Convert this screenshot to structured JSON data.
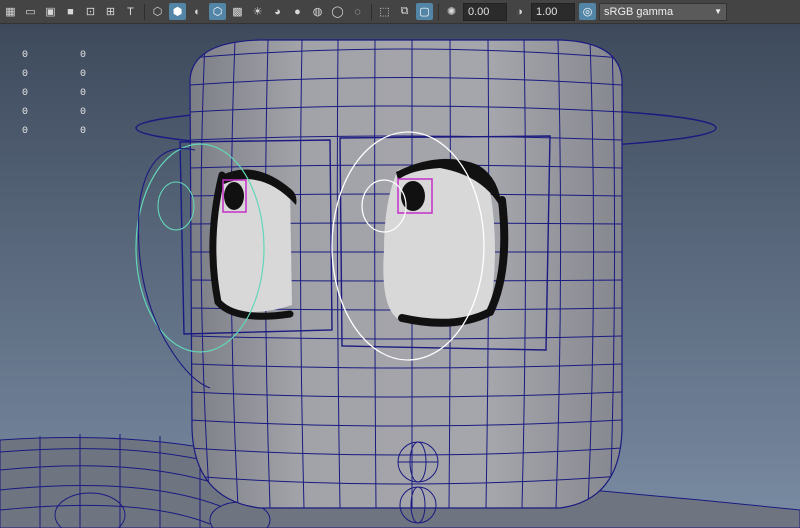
{
  "toolbar": {
    "icons": [
      {
        "name": "camera-attributes-icon",
        "glyph": "▦",
        "active": false
      },
      {
        "name": "image-plane-icon",
        "glyph": "▭",
        "active": false
      },
      {
        "name": "film-gate-icon",
        "glyph": "▣",
        "active": false
      },
      {
        "name": "resolution-gate-icon",
        "glyph": "■",
        "active": false
      },
      {
        "name": "safe-action-icon",
        "glyph": "⊡",
        "active": false
      },
      {
        "name": "grid-icon",
        "glyph": "⊞",
        "active": false
      },
      {
        "name": "text-field-icon",
        "glyph": "T",
        "active": false
      },
      {
        "name": "wireframe-icon",
        "glyph": "⬡",
        "active": false
      },
      {
        "name": "smooth-shade-icon",
        "glyph": "⬢",
        "active": true
      },
      {
        "name": "shadows-icon",
        "glyph": "◐",
        "active": false
      },
      {
        "name": "wireframe-on-shaded-icon",
        "glyph": "⬡",
        "active": true
      },
      {
        "name": "textured-icon",
        "glyph": "▩",
        "active": false
      },
      {
        "name": "lighting-icon",
        "glyph": "☀",
        "active": false
      },
      {
        "name": "xray-icon",
        "glyph": "◕",
        "active": false
      },
      {
        "name": "ambient-occlusion-icon",
        "glyph": "●",
        "active": false
      },
      {
        "name": "motion-blur-icon",
        "glyph": "◍",
        "active": false
      },
      {
        "name": "anti-alias-icon",
        "glyph": "◯",
        "active": false
      },
      {
        "name": "depth-of-field-icon",
        "glyph": "◌",
        "active": false
      },
      {
        "name": "isolate-select-icon",
        "glyph": "⬚",
        "active": false
      },
      {
        "name": "xray-joints-icon",
        "glyph": "⧉",
        "active": false
      },
      {
        "name": "xray-components-icon",
        "glyph": "▢",
        "active": true
      }
    ],
    "exposure_icon": "exposure-icon",
    "exposure_value": "0.00",
    "gamma_icon": "gamma-icon",
    "gamma_value": "1.00",
    "color_mgmt_icon": "color-management-icon",
    "color_space": "sRGB gamma",
    "dropdown_glyph": "▼"
  },
  "hud": {
    "rows": [
      [
        "0",
        "0"
      ],
      [
        "0",
        "0"
      ],
      [
        "0",
        "0"
      ],
      [
        "0",
        "0"
      ],
      [
        "0",
        "0"
      ]
    ]
  },
  "colors": {
    "viewport_bg_top": "#3e4a5c",
    "viewport_bg_bottom": "#7a8ca3",
    "mesh_fill": "#9a9aa0",
    "wire": "#1a1a80",
    "selected_curve": "#ffffff",
    "secondary_curve": "#62d6b8",
    "pupil_box": "#c42fc8"
  }
}
